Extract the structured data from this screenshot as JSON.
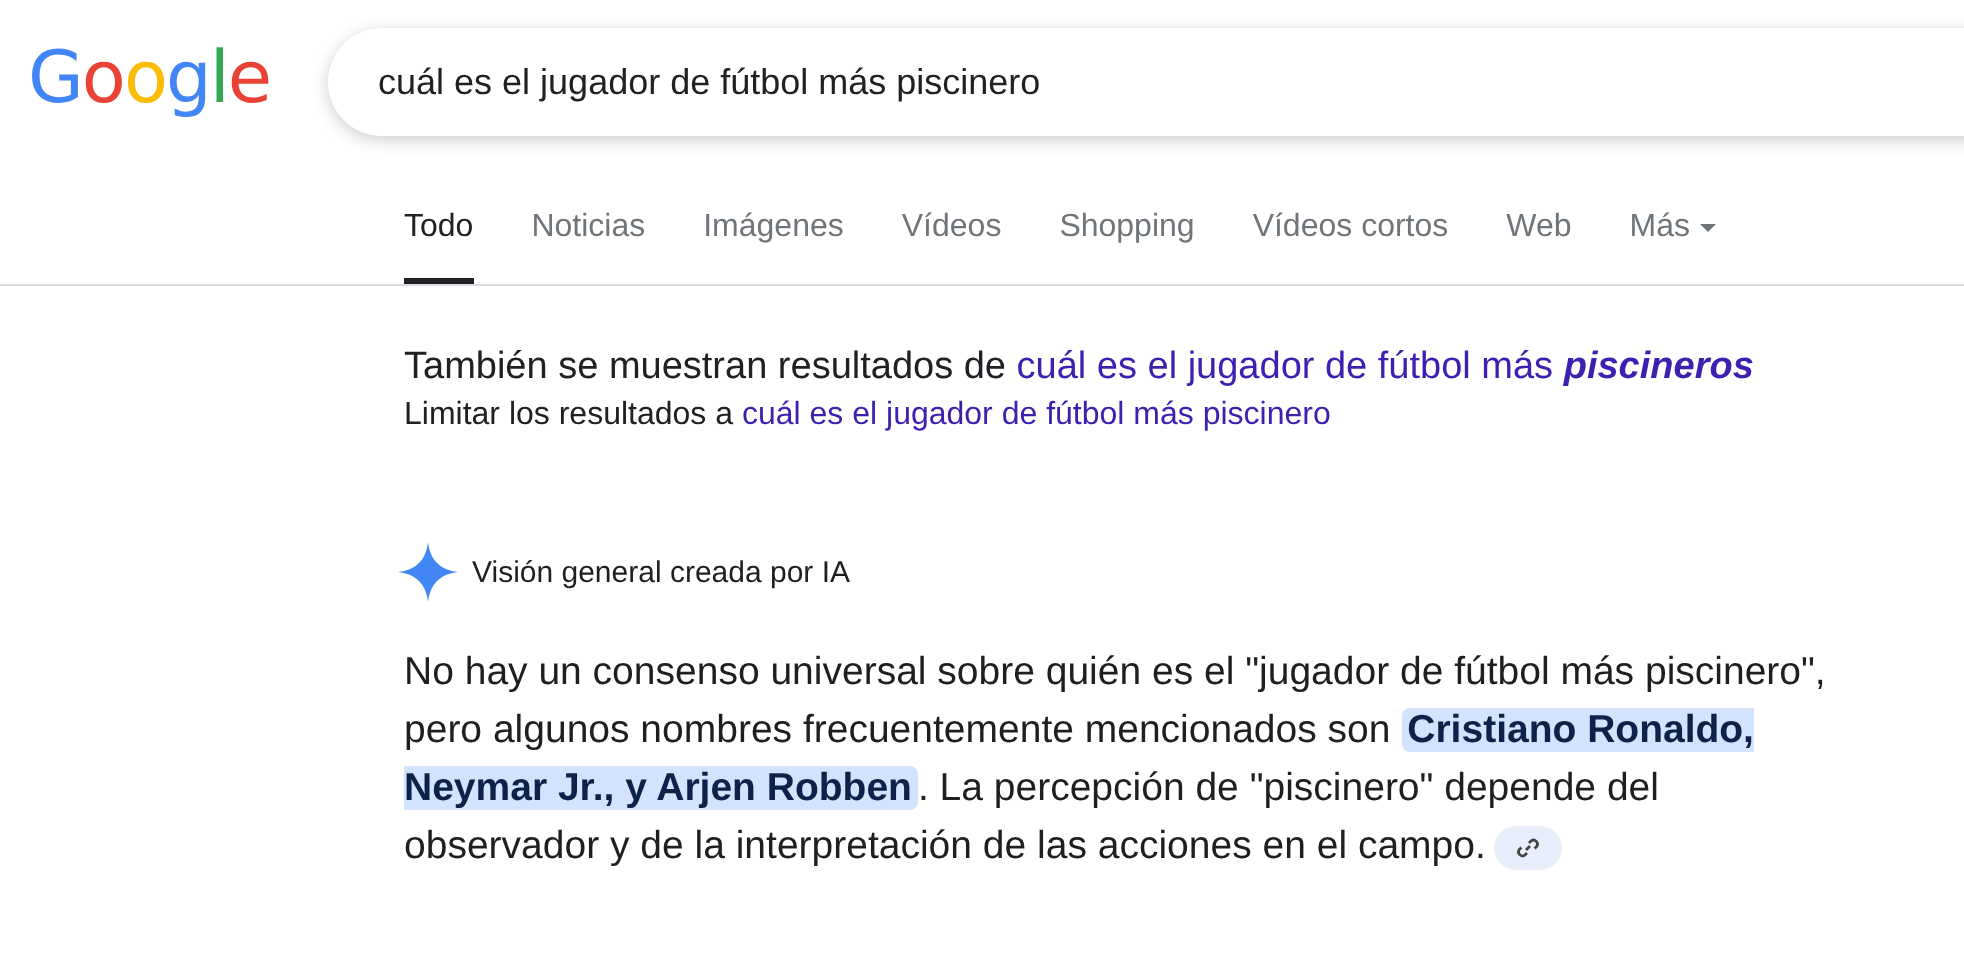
{
  "logo": {
    "text": "Google"
  },
  "search": {
    "value": "cuál es el jugador de fútbol más piscinero"
  },
  "tabs": [
    {
      "label": "Todo",
      "selected": true,
      "kind": "tab"
    },
    {
      "label": "Noticias",
      "selected": false,
      "kind": "tab"
    },
    {
      "label": "Imágenes",
      "selected": false,
      "kind": "tab"
    },
    {
      "label": "Vídeos",
      "selected": false,
      "kind": "tab"
    },
    {
      "label": "Shopping",
      "selected": false,
      "kind": "tab"
    },
    {
      "label": "Vídeos cortos",
      "selected": false,
      "kind": "tab"
    },
    {
      "label": "Web",
      "selected": false,
      "kind": "tab"
    },
    {
      "label": "Más",
      "selected": false,
      "kind": "menu"
    }
  ],
  "spelling": {
    "prefix": "También se muestran resultados de ",
    "link": "cuál es el jugador de fútbol más **piscineros**"
  },
  "limit": {
    "prefix": "Limitar los resultados a ",
    "link": "cuál es el jugador de fútbol más piscinero"
  },
  "ai_overview": {
    "title": "Visión general creada por IA",
    "text": "No hay un consenso universal sobre quién es el \"jugador de fútbol más piscinero\", pero algunos nombres frecuentemente mencionados son **Cristiano Ronaldo, Neymar Jr., y Arjen Robben**. La percepción de \"piscinero\" depende del observador y de la interpretación de las acciones en el campo."
  }
}
